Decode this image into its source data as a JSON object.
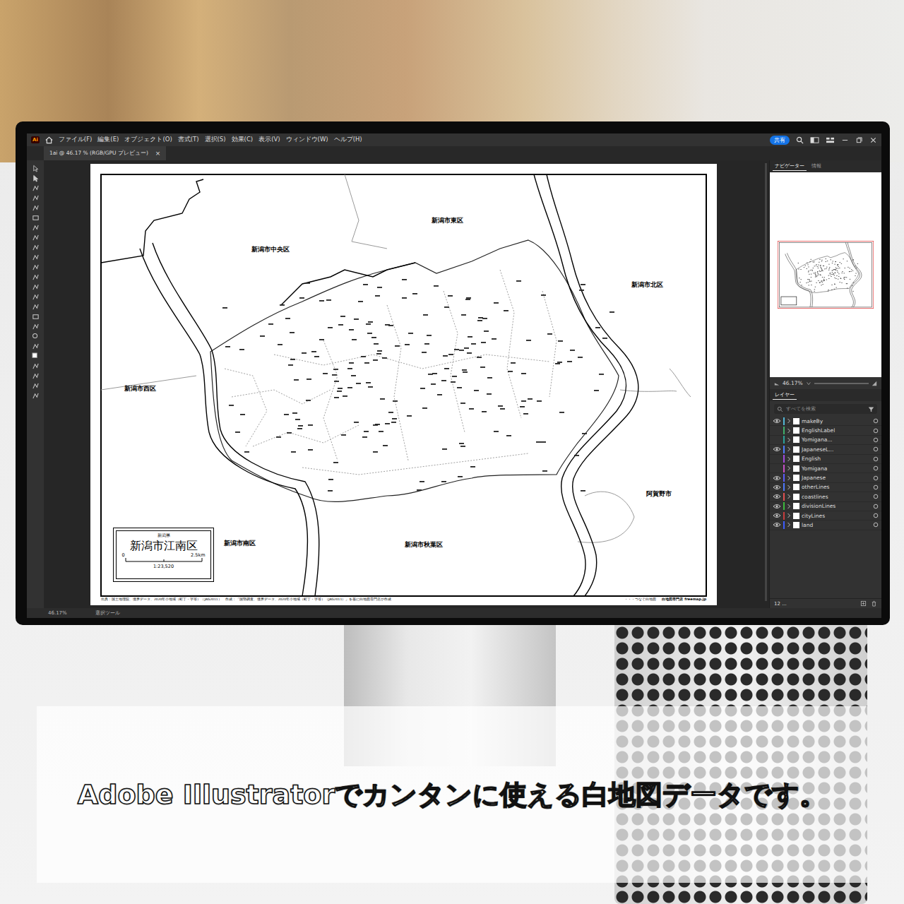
{
  "window": {
    "app_icon": "Ai",
    "menu": [
      "ファイル(F)",
      "編集(E)",
      "オブジェクト(O)",
      "書式(T)",
      "選択(S)",
      "効果(C)",
      "表示(V)",
      "ウィンドウ(W)",
      "ヘルプ(H)"
    ],
    "share_button": "共有"
  },
  "document_tab": {
    "title": "1ai @ 46.17 % (RGB/GPU プレビュー)",
    "close": "×"
  },
  "map": {
    "labels": [
      "新潟市東区",
      "新潟市中央区",
      "新潟市北区",
      "新潟市西区",
      "阿賀野市",
      "新潟市南区",
      "新潟市秋葉区"
    ],
    "legend": {
      "prefecture": "新潟県",
      "title": "新潟市江南区",
      "scale_start": "0",
      "scale_end": "2.5km",
      "ratio": "1:23,520"
    },
    "footer": {
      "source": "出典：国土地理院、境界データ、2020年小地域（町丁・字等）（JAG2011）　作成：「国勢調査、境界データ、2020年小地域（町丁・字等）（JAG2011）」を基に白地図専門店が作成",
      "brand": "・・・つなぐ白地図",
      "credit": "白地図専門店 freemap.jp"
    }
  },
  "navigator": {
    "tabs": [
      {
        "label": "ナビゲーター",
        "selected": true
      },
      {
        "label": "情報",
        "selected": false
      }
    ],
    "zoom": "46.17%"
  },
  "layers": {
    "tabs": [
      {
        "label": "レイヤー",
        "selected": true
      }
    ],
    "search_placeholder": "すべてを検索",
    "count": "12 ...",
    "items": [
      {
        "name": "makeBy",
        "visible": true,
        "color": "#52b6d6"
      },
      {
        "name": "EnglishLabel",
        "visible": false,
        "color": "#3fae6a"
      },
      {
        "name": "Yomigana...",
        "visible": false,
        "color": "#2aa198"
      },
      {
        "name": "JapaneseL...",
        "visible": true,
        "color": "#4f7cff"
      },
      {
        "name": "English",
        "visible": false,
        "color": "#a349e0"
      },
      {
        "name": "Yomigana",
        "visible": false,
        "color": "#c850c8"
      },
      {
        "name": "Japanese",
        "visible": true,
        "color": "#5b5bff"
      },
      {
        "name": "otherLines",
        "visible": true,
        "color": "#4e79ff"
      },
      {
        "name": "coastlines",
        "visible": true,
        "color": "#e05050"
      },
      {
        "name": "divisionLines",
        "visible": true,
        "color": "#3cba3c"
      },
      {
        "name": "cityLines",
        "visible": true,
        "color": "#c83c3c"
      },
      {
        "name": "land",
        "visible": true,
        "color": "#3c5cff"
      }
    ]
  },
  "status_bar": {
    "zoom": "46.17%",
    "tool": "選択ツール"
  },
  "caption": "Adobe Illustratorでカンタンに使える白地図データです。"
}
